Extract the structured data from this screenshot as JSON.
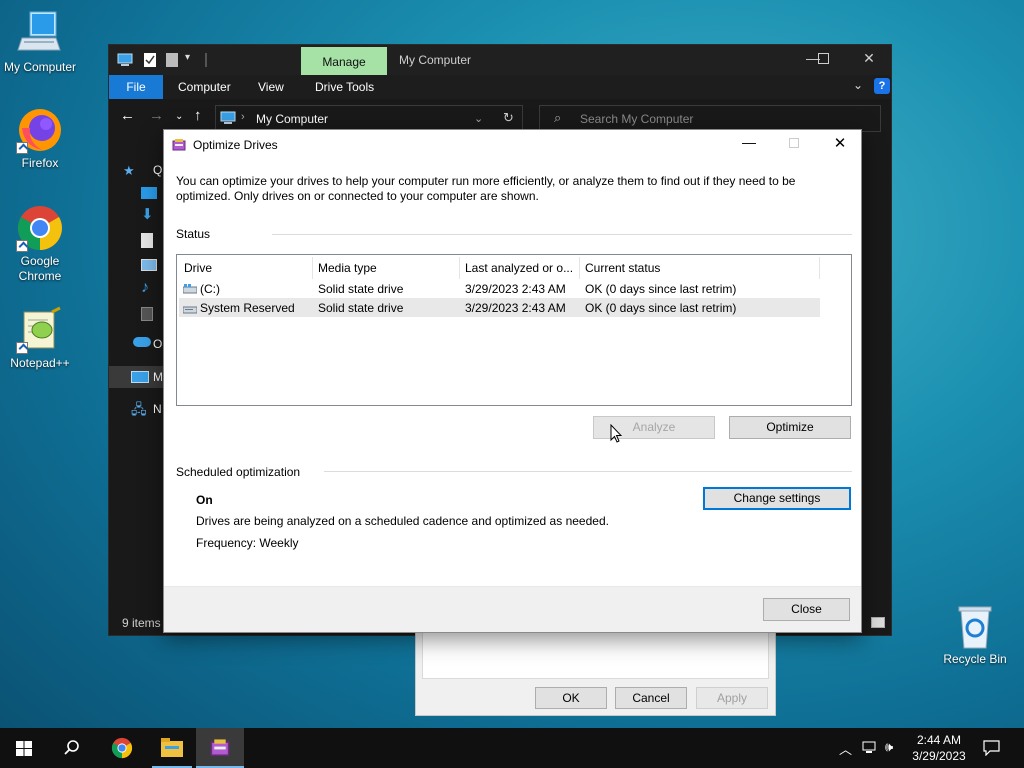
{
  "desktop": {
    "icons": [
      {
        "label": "My Computer"
      },
      {
        "label": "Firefox"
      },
      {
        "label": "Google Chrome"
      },
      {
        "label": "Notepad++"
      },
      {
        "label": "Recycle Bin"
      }
    ]
  },
  "explorer": {
    "manage_tab": "Manage",
    "title": "My Computer",
    "ribbon": [
      "File",
      "Computer",
      "View",
      "Drive Tools"
    ],
    "address": "My Computer",
    "search_placeholder": "Search My Computer",
    "navpane": [
      "Q",
      "O",
      "M",
      "N"
    ],
    "status": "9 items"
  },
  "properties": {
    "ok": "OK",
    "cancel": "Cancel",
    "apply": "Apply"
  },
  "dialog": {
    "title": "Optimize Drives",
    "description": "You can optimize your drives to help your computer run more efficiently, or analyze them to find out if they need to be optimized. Only drives on or connected to your computer are shown.",
    "status_label": "Status",
    "columns": [
      "Drive",
      "Media type",
      "Last analyzed or o...",
      "Current status"
    ],
    "drives": [
      {
        "drive": "(C:)",
        "media": "Solid state drive",
        "last": "3/29/2023 2:43 AM",
        "status": "OK (0 days since last retrim)"
      },
      {
        "drive": "System Reserved",
        "media": "Solid state drive",
        "last": "3/29/2023 2:43 AM",
        "status": "OK (0 days since last retrim)"
      }
    ],
    "analyze": "Analyze",
    "optimize": "Optimize",
    "scheduled_label": "Scheduled optimization",
    "sched_state": "On",
    "sched_desc": "Drives are being analyzed on a scheduled cadence and optimized as needed.",
    "sched_freq": "Frequency: Weekly",
    "change_settings": "Change settings",
    "close": "Close"
  },
  "taskbar": {
    "time": "2:44 AM",
    "date": "3/29/2023"
  },
  "colors": {
    "accent": "#0078d7",
    "manage_tab": "#a6e1a6",
    "file_tab": "#197ad6"
  }
}
